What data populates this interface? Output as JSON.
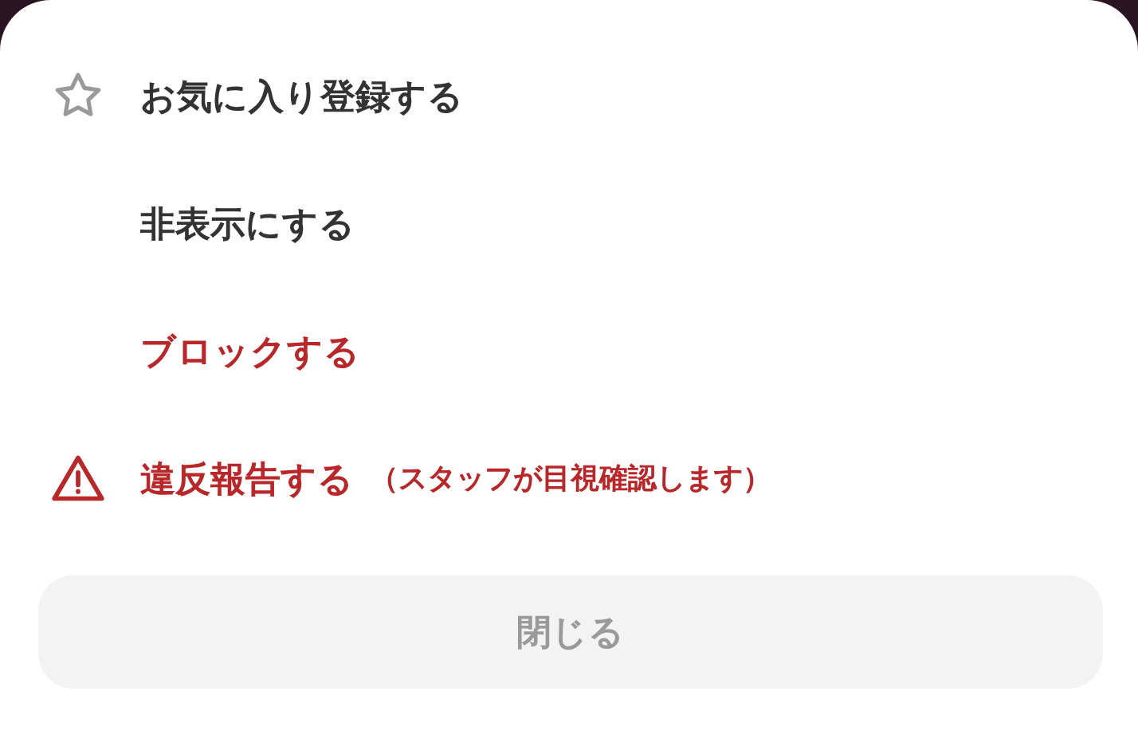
{
  "menu": {
    "items": [
      {
        "kind": "favorite",
        "label": "お気に入り登録する"
      },
      {
        "kind": "hide",
        "label": "非表示にする"
      },
      {
        "kind": "block",
        "label": "ブロックする"
      },
      {
        "kind": "report",
        "label": "違反報告する",
        "note": "（スタッフが目視確認します）"
      }
    ]
  },
  "close_button": {
    "label": "閉じる"
  }
}
